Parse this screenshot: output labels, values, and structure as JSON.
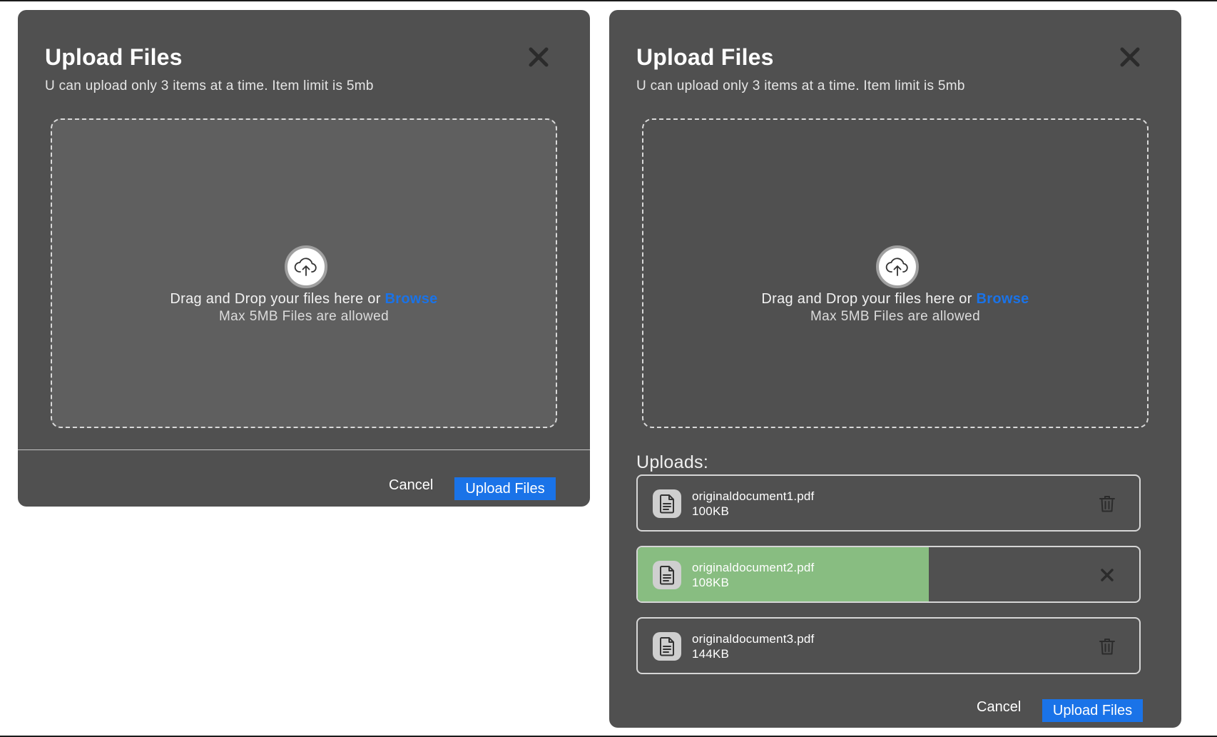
{
  "dialog_empty": {
    "title": "Upload Files",
    "subtitle": "U can upload only 3 items at a time. Item limit is 5mb",
    "dropzone": {
      "text": "Drag and Drop your files here or",
      "browse_link": "Browse",
      "subtext": "Max 5MB Files are allowed"
    },
    "cancel_label": "Cancel",
    "upload_label": "Upload Files"
  },
  "dialog_uploads": {
    "title": "Upload Files",
    "subtitle": "U can upload only 3 items at a time. Item limit is 5mb",
    "dropzone": {
      "text": "Drag and Drop your files here or",
      "browse_link": "Browse",
      "subtext": "Max 5MB Files are allowed"
    },
    "uploads_heading": "Uploads:",
    "files": [
      {
        "name": "originaldocument1.pdf",
        "size": "100KB",
        "status": "complete",
        "action_icon": "trash-icon"
      },
      {
        "name": "originaldocument2.pdf",
        "size": "108KB",
        "status": "uploading",
        "progress": 0.58,
        "action_icon": "close-icon"
      },
      {
        "name": "originaldocument3.pdf",
        "size": "144KB",
        "status": "complete",
        "action_icon": "trash-icon"
      }
    ],
    "cancel_label": "Cancel",
    "upload_label": "Upload Files"
  },
  "colors": {
    "modal_bg": "#505050",
    "dropzone_bg_empty": "#5f5f5f",
    "accent": "#1a73e8",
    "progress": "#88bd81",
    "text": "#ffffff"
  },
  "icons": {
    "close": "close-icon",
    "upload": "cloud-upload-icon",
    "file": "document-icon",
    "delete": "trash-icon"
  }
}
